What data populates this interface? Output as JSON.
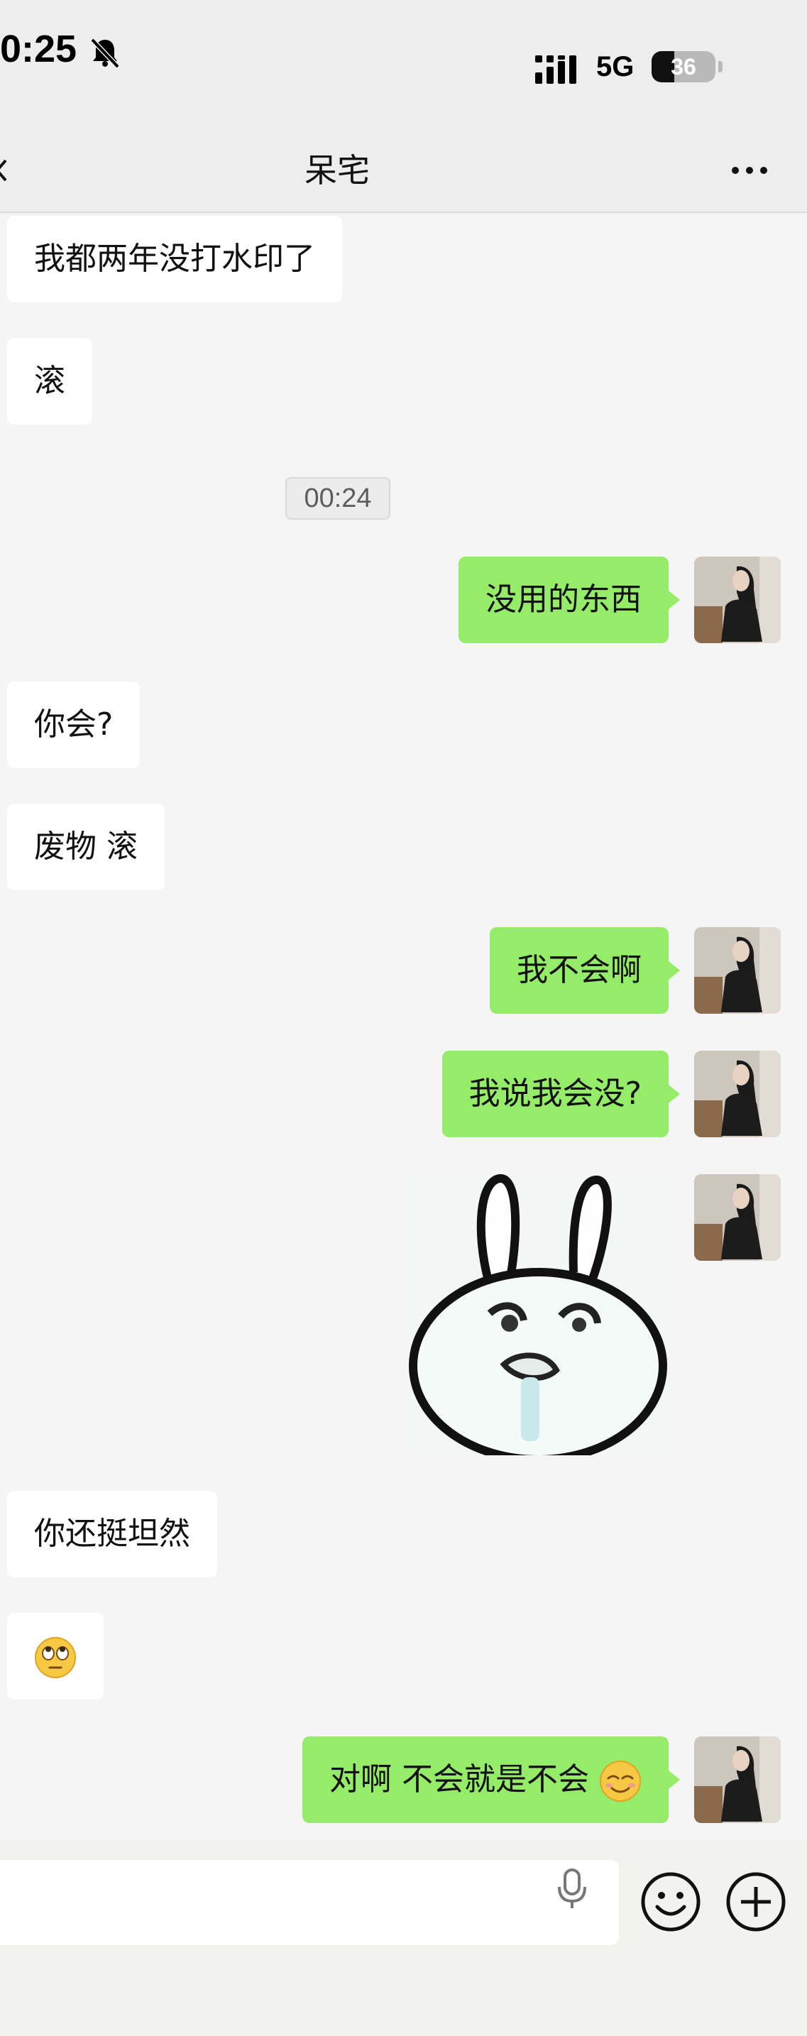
{
  "status_bar": {
    "time": "0:25",
    "network": "5G",
    "battery_percent": "36",
    "battery_level_fraction": 0.36,
    "icons": [
      "bell-slash-icon",
      "signal-icon",
      "battery-icon"
    ]
  },
  "header": {
    "title": "呆宅",
    "more_icon": "ellipsis-icon"
  },
  "messages": [
    {
      "side": "left",
      "text": "我都两年没打水印了"
    },
    {
      "side": "left",
      "text": "滚"
    },
    {
      "type": "timestamp",
      "text": "00:24"
    },
    {
      "side": "right",
      "text": "没用的东西"
    },
    {
      "side": "left",
      "text": "你会?"
    },
    {
      "side": "left",
      "text": "废物 滚"
    },
    {
      "side": "right",
      "text": "我不会啊"
    },
    {
      "side": "right",
      "text": "我说我会没?"
    },
    {
      "side": "right",
      "type": "sticker",
      "sticker": "bunny-sticker"
    },
    {
      "side": "left",
      "text": "你还挺坦然"
    },
    {
      "side": "left",
      "emoji": "face-with-rolling-eyes"
    },
    {
      "side": "right",
      "text": "对啊 不会就是不会",
      "emoji": "relieved-face"
    }
  ],
  "input_bar": {
    "placeholder": "",
    "icons": [
      "microphone-icon",
      "emoji-icon",
      "plus-icon"
    ]
  },
  "colors": {
    "background": "#ededed",
    "chat_background": "#f5f5f5",
    "own_bubble": "#95ec69",
    "other_bubble": "#ffffff"
  }
}
